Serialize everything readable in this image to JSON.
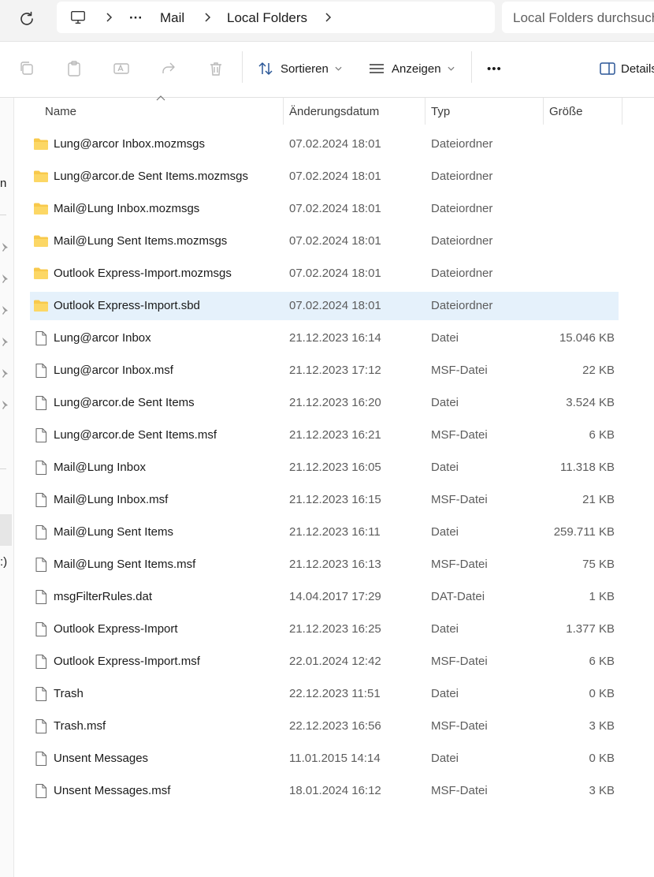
{
  "breadcrumb": {
    "more": "···",
    "items": [
      "Mail",
      "Local Folders"
    ]
  },
  "search": {
    "placeholder": "Local Folders durchsuchen"
  },
  "toolbar": {
    "sort_label": "Sortieren",
    "view_label": "Anzeigen",
    "more_label": "•••",
    "details_label": "Details"
  },
  "nav_fragments": [
    "n",
    ":)"
  ],
  "columns": {
    "name": "Name",
    "date": "Änderungsdatum",
    "type": "Typ",
    "size": "Größe"
  },
  "files": [
    {
      "name": "Lung@arcor Inbox.mozmsgs",
      "date": "07.02.2024 18:01",
      "type": "Dateiordner",
      "size": "",
      "kind": "folder"
    },
    {
      "name": "Lung@arcor.de Sent Items.mozmsgs",
      "date": "07.02.2024 18:01",
      "type": "Dateiordner",
      "size": "",
      "kind": "folder"
    },
    {
      "name": "Mail@Lung Inbox.mozmsgs",
      "date": "07.02.2024 18:01",
      "type": "Dateiordner",
      "size": "",
      "kind": "folder"
    },
    {
      "name": "Mail@Lung Sent Items.mozmsgs",
      "date": "07.02.2024 18:01",
      "type": "Dateiordner",
      "size": "",
      "kind": "folder"
    },
    {
      "name": "Outlook Express-Import.mozmsgs",
      "date": "07.02.2024 18:01",
      "type": "Dateiordner",
      "size": "",
      "kind": "folder"
    },
    {
      "name": "Outlook Express-Import.sbd",
      "date": "07.02.2024 18:01",
      "type": "Dateiordner",
      "size": "",
      "kind": "folder",
      "selected": true
    },
    {
      "name": "Lung@arcor Inbox",
      "date": "21.12.2023 16:14",
      "type": "Datei",
      "size": "15.046 KB",
      "kind": "file"
    },
    {
      "name": "Lung@arcor Inbox.msf",
      "date": "21.12.2023 17:12",
      "type": "MSF-Datei",
      "size": "22 KB",
      "kind": "file"
    },
    {
      "name": "Lung@arcor.de Sent Items",
      "date": "21.12.2023 16:20",
      "type": "Datei",
      "size": "3.524 KB",
      "kind": "file"
    },
    {
      "name": "Lung@arcor.de Sent Items.msf",
      "date": "21.12.2023 16:21",
      "type": "MSF-Datei",
      "size": "6 KB",
      "kind": "file"
    },
    {
      "name": "Mail@Lung Inbox",
      "date": "21.12.2023 16:05",
      "type": "Datei",
      "size": "11.318 KB",
      "kind": "file"
    },
    {
      "name": "Mail@Lung Inbox.msf",
      "date": "21.12.2023 16:15",
      "type": "MSF-Datei",
      "size": "21 KB",
      "kind": "file"
    },
    {
      "name": "Mail@Lung Sent Items",
      "date": "21.12.2023 16:11",
      "type": "Datei",
      "size": "259.711 KB",
      "kind": "file"
    },
    {
      "name": "Mail@Lung Sent Items.msf",
      "date": "21.12.2023 16:13",
      "type": "MSF-Datei",
      "size": "75 KB",
      "kind": "file"
    },
    {
      "name": "msgFilterRules.dat",
      "date": "14.04.2017 17:29",
      "type": "DAT-Datei",
      "size": "1 KB",
      "kind": "file"
    },
    {
      "name": "Outlook Express-Import",
      "date": "21.12.2023 16:25",
      "type": "Datei",
      "size": "1.377 KB",
      "kind": "file"
    },
    {
      "name": "Outlook Express-Import.msf",
      "date": "22.01.2024 12:42",
      "type": "MSF-Datei",
      "size": "6 KB",
      "kind": "file"
    },
    {
      "name": "Trash",
      "date": "22.12.2023 11:51",
      "type": "Datei",
      "size": "0 KB",
      "kind": "file"
    },
    {
      "name": "Trash.msf",
      "date": "22.12.2023 16:56",
      "type": "MSF-Datei",
      "size": "3 KB",
      "kind": "file"
    },
    {
      "name": "Unsent Messages",
      "date": "11.01.2015 14:14",
      "type": "Datei",
      "size": "0 KB",
      "kind": "file"
    },
    {
      "name": "Unsent Messages.msf",
      "date": "18.01.2024 16:12",
      "type": "MSF-Datei",
      "size": "3 KB",
      "kind": "file"
    }
  ],
  "colors": {
    "selected_row": "#e5f1fb",
    "folder_icon": "#f8c94b",
    "toolbar_bg": "#f3f3f3"
  }
}
